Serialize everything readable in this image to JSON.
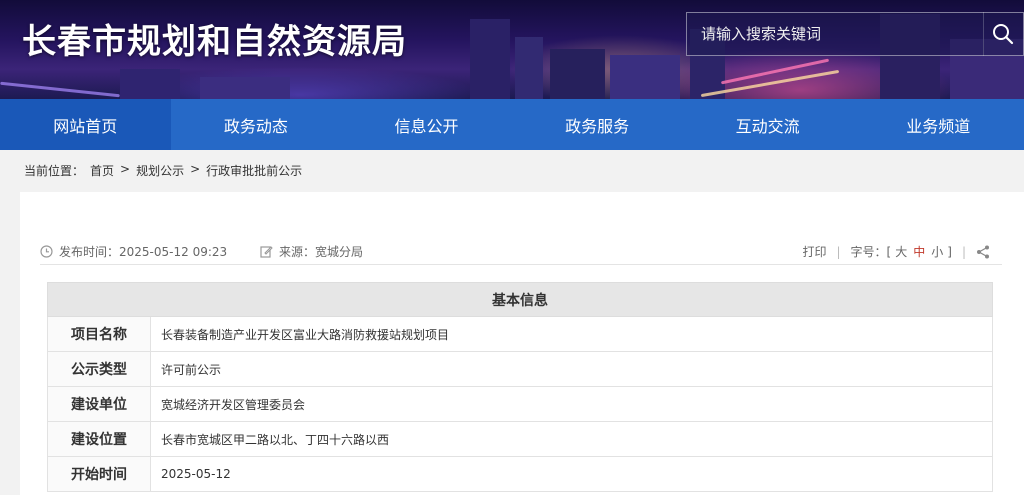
{
  "header": {
    "site_title": "长春市规划和自然资源局",
    "search_placeholder": "请输入搜索关键词"
  },
  "nav": {
    "items": [
      "网站首页",
      "政务动态",
      "信息公开",
      "政务服务",
      "互动交流",
      "业务频道"
    ],
    "active_index": 0
  },
  "breadcrumb": {
    "prefix": "当前位置：",
    "items": [
      "首页",
      "规划公示",
      "行政审批批前公示"
    ],
    "separator": ">"
  },
  "meta": {
    "publish_label": "发布时间：",
    "publish_time": "2025-05-12 09:23",
    "source_label": "来源：",
    "source": "宽城分局",
    "print_label": "打印",
    "font_label": "字号：",
    "font_open": "[",
    "font_large": "大",
    "font_medium": "中",
    "font_small": "小",
    "font_close": "]",
    "sep": "|"
  },
  "table": {
    "title": "基本信息",
    "rows": [
      {
        "label": "项目名称",
        "value": "长春装备制造产业开发区富业大路消防救援站规划项目"
      },
      {
        "label": "公示类型",
        "value": "许可前公示"
      },
      {
        "label": "建设单位",
        "value": "宽城经济开发区管理委员会"
      },
      {
        "label": "建设位置",
        "value": "长春市宽城区甲二路以北、丁四十六路以西"
      },
      {
        "label": "开始时间",
        "value": "2025-05-12"
      }
    ]
  }
}
